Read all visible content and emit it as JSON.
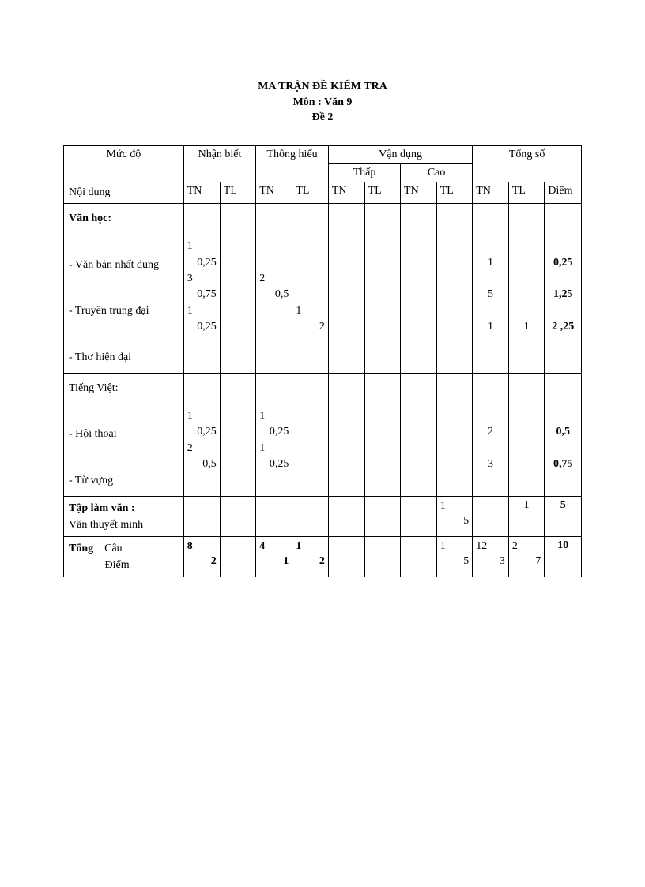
{
  "title": "MA TRẬN ĐỀ KIỂM TRA",
  "subject": "Môn : Văn 9",
  "exam_no": "Đề 2",
  "headers": {
    "level": "Mức độ",
    "content": "Nội dung",
    "recognize": "Nhận biết",
    "understand": "Thông hiểu",
    "apply": "Vận dụng",
    "apply_low": "Thấp",
    "apply_high": "Cao",
    "total": "Tổng số",
    "tn": "TN",
    "tl": "TL",
    "points": "Điểm"
  },
  "sections": {
    "literature": {
      "heading": "Văn học:",
      "items": [
        {
          "label": "- Văn bản nhất dụng",
          "nb_tn_q": "1",
          "nb_tn_p": "0,25",
          "tot_tn": "1",
          "tot_pts": "0,25"
        },
        {
          "label": "- Truyên trung đại",
          "nb_tn_q": "3",
          "nb_tn_p": "0,75",
          "th_tn_q": "2",
          "th_tn_p": "0,5",
          "tot_tn": "5",
          "tot_pts": "1,25"
        },
        {
          "label": "- Thơ hiện đại",
          "nb_tn_q": "1",
          "nb_tn_p": "0,25",
          "th_tl_q": "1",
          "th_tl_p": "2",
          "tot_tn": "1",
          "tot_tl": "1",
          "tot_pts": "2 ,25"
        }
      ]
    },
    "vietnamese": {
      "heading": "Tiếng Việt:",
      "items": [
        {
          "label": "- Hội thoại",
          "nb_tn_q": "1",
          "nb_tn_p": "0,25",
          "th_tn_q": "1",
          "th_tn_p": "0,25",
          "tot_tn": "2",
          "tot_pts": "0,5"
        },
        {
          "label": "- Từ vựng",
          "nb_tn_q": "2",
          "nb_tn_p": "0,5",
          "th_tn_q": "1",
          "th_tn_p": "0,25",
          "tot_tn": "3",
          "tot_pts": "0,75"
        }
      ]
    },
    "writing": {
      "heading": "Tập làm văn :",
      "sub": "Văn thuyết minh",
      "vd_cao_tl_q": "1",
      "vd_cao_tl_p": "5",
      "tot_tl": "1",
      "tot_pts": "5"
    },
    "total": {
      "label": "Tổng",
      "row1": "Câu",
      "row2": "Điểm",
      "nb_tn_q": "8",
      "nb_tn_p": "2",
      "th_tn_q": "4",
      "th_tn_p": "1",
      "th_tl_q": "1",
      "th_tl_p": "2",
      "vd_cao_tl_q": "1",
      "vd_cao_tl_p": "5",
      "tot_tn_q": "12",
      "tot_tn_p": "3",
      "tot_tl_q": "2",
      "tot_tl_p": "7",
      "tot_pts": "10"
    }
  }
}
